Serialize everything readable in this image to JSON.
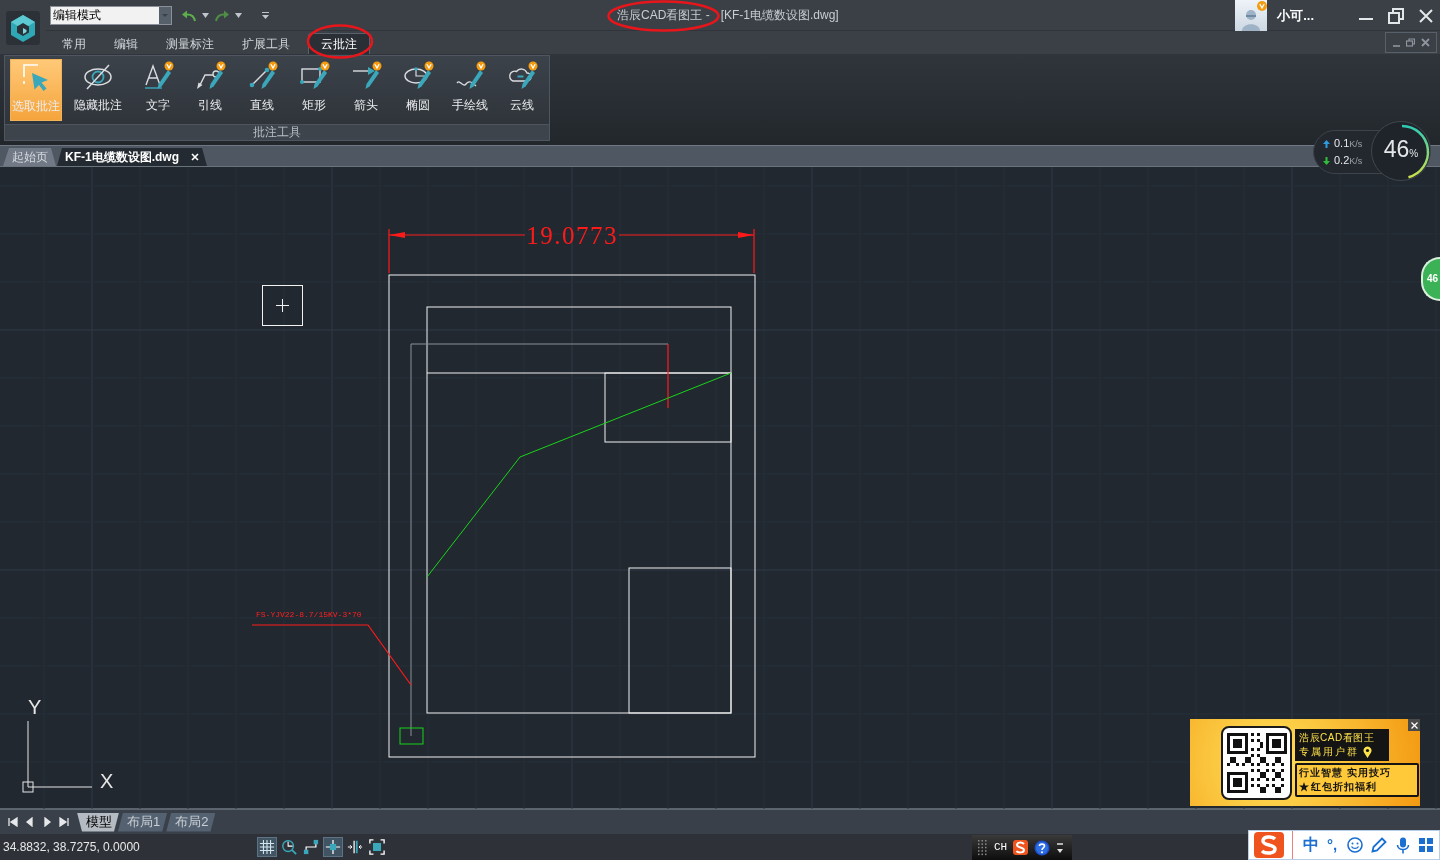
{
  "title_bar": {
    "mode_select": {
      "value": "编辑模式"
    },
    "app_title": "浩辰CAD看图王 -",
    "document_title": "[KF-1电缆数设图.dwg]",
    "user_name": "小可..."
  },
  "menu_tabs": [
    {
      "label": "常用",
      "selected": false
    },
    {
      "label": "编辑",
      "selected": false
    },
    {
      "label": "测量标注",
      "selected": false
    },
    {
      "label": "扩展工具",
      "selected": false
    },
    {
      "label": "云批注",
      "selected": true
    }
  ],
  "ribbon": {
    "tools": [
      {
        "kind": "select",
        "label": "选取批注",
        "selected": true
      },
      {
        "kind": "hide",
        "label": "隐藏批注",
        "selected": false
      },
      {
        "kind": "text",
        "label": "文字",
        "selected": false
      },
      {
        "kind": "leader",
        "label": "引线",
        "selected": false
      },
      {
        "kind": "line",
        "label": "直线",
        "selected": false
      },
      {
        "kind": "rectangle",
        "label": "矩形",
        "selected": false
      },
      {
        "kind": "arrow",
        "label": "箭头",
        "selected": false
      },
      {
        "kind": "ellipse",
        "label": "椭圆",
        "selected": false
      },
      {
        "kind": "freehand",
        "label": "手绘线",
        "selected": false
      },
      {
        "kind": "cloud",
        "label": "云线",
        "selected": false
      }
    ],
    "group_label": "批注工具"
  },
  "document_tabs": [
    {
      "label": "起始页",
      "selected": false
    },
    {
      "label": "KF-1电缆数设图.dwg",
      "selected": true
    }
  ],
  "net_monitor": {
    "upload": {
      "value": "0.1",
      "unit": "K/s"
    },
    "download": {
      "value": "0.2",
      "unit": "K/s"
    },
    "usage": {
      "value": "46",
      "unit": "%",
      "level": 0.46
    }
  },
  "side_badge": {
    "value": "46"
  },
  "drawing": {
    "dimension": "19.0773",
    "cable_label": "FS-YJV22-8.7/15KV-3*70",
    "axis_labels": {
      "y": "Y",
      "x": "X"
    }
  },
  "layout_tabs": [
    {
      "label": "模型",
      "selected": true
    },
    {
      "label": "布局1",
      "selected": false
    },
    {
      "label": "布局2",
      "selected": false
    }
  ],
  "status_bar": {
    "coordinates": "34.8832, 38.7275, 0.0000",
    "tools": [
      {
        "kind": "grid",
        "on": true
      },
      {
        "kind": "zoom",
        "on": false
      },
      {
        "kind": "snap",
        "on": false
      },
      {
        "kind": "crosshair",
        "on": true
      },
      {
        "kind": "ortho",
        "on": false
      },
      {
        "kind": "fullscreen",
        "on": false
      }
    ]
  },
  "ime_toolbar": {
    "language": "CH"
  },
  "ad_popup": {
    "title": "浩辰CAD看图王",
    "subtitle": "专属用户群",
    "features": [
      "行业智慧 实用技巧",
      "红包折扣福利"
    ]
  },
  "ime_bar": {
    "mode": "中",
    "punctuation": "°,"
  }
}
